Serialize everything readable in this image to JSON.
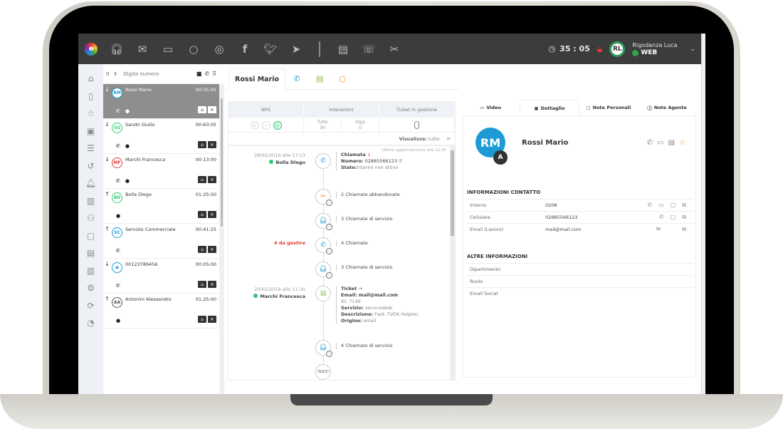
{
  "topbar": {
    "icons": [
      "logo-icon",
      "headset-icon",
      "mail-icon",
      "video-icon",
      "chat-icon",
      "webchat-icon",
      "facebook-icon",
      "twitter-icon",
      "telegram-icon",
      "clipboard-icon",
      "callback-icon",
      "hangup-icon"
    ],
    "timer": "35 : 05",
    "user": {
      "initials": "RL",
      "name": "Rigodanza Luca",
      "status": "WEB"
    }
  },
  "leftnav": {
    "items": [
      "home",
      "bookmark",
      "star",
      "contacts",
      "menu",
      "history",
      "bell",
      "fax",
      "team",
      "notes",
      "clipboard",
      "stats",
      "settings",
      "sync",
      "dashboard"
    ]
  },
  "dialer": {
    "prefix": "0",
    "placeholder": "Digita numero"
  },
  "calls": [
    {
      "dir": "↓",
      "initials": "RM",
      "name": "Rossi Mario",
      "time": "00:35:05",
      "color": "#1e9bd7",
      "channels": [
        "phone",
        "chat"
      ],
      "active": true
    },
    {
      "dir": "↓",
      "initials": "SG",
      "name": "Sandri Giulio",
      "time": "00:63:05",
      "color": "#2ecc71",
      "channels": [
        "phone",
        "chat"
      ],
      "active": false
    },
    {
      "dir": "↓",
      "initials": "MF",
      "name": "Marchi Francesca",
      "time": "00:13:00",
      "color": "#e53935",
      "channels": [
        "phone",
        "chat"
      ],
      "active": false
    },
    {
      "dir": "↑",
      "initials": "BD",
      "name": "Bolla Diego",
      "time": "01:25:00",
      "color": "#2ecc71",
      "channels": [
        "chat"
      ],
      "active": false
    },
    {
      "dir": "↑",
      "initials": "SC",
      "name": "Servizio Commerciale",
      "time": "00:41:25",
      "color": "#1e9bd7",
      "channels": [
        "phone"
      ],
      "active": false
    },
    {
      "dir": "↓",
      "initials": "◉",
      "name": "00123789456",
      "time": "00:05:00",
      "color": "#1e9bd7",
      "channels": [
        "phone"
      ],
      "active": false
    },
    {
      "dir": "↑",
      "initials": "AA",
      "name": "Antonini Alessandro",
      "time": "01:25:00",
      "color": "#555555",
      "channels": [
        "chat"
      ],
      "active": false
    }
  ],
  "center": {
    "tab_title": "Rossi Mario",
    "stats": {
      "nps_label": "NPS",
      "interactions_label": "Interazioni",
      "tickets_label": "Ticket in gestione",
      "all_label": "Tutte",
      "all_value": "30",
      "today_label": "Oggi",
      "today_value": "0",
      "tickets_value": "0"
    },
    "view_label": "Visualizza:",
    "view_value": "tutto",
    "updated": "Ultimo aggiornamento alle 11:35",
    "timeline": {
      "e1_date": "28/02/2019 alle 17:13",
      "e1_who": "Bolla Diego",
      "e1_title": "Chiamata",
      "e1_num_lbl": "Numero:",
      "e1_num": "02885566123",
      "e1_state_lbl": "Stato:",
      "e1_state": "interno non attivo",
      "e2": "2 Chiamate abbandonate",
      "e3": "3 Chiamate di servizio",
      "e4_pending": "4 da gestire",
      "e4": "4 Chiamate",
      "e5": "3 Chiamate di servizio",
      "e6_date": "20/02/2019 alle 11:30",
      "e6_who": "Marchi Francesca",
      "e6_title": "Ticket",
      "e6_email": "Email: mail@mail.com",
      "e6_id_lbl": "ID:",
      "e6_id": "7149",
      "e6_srv_lbl": "Servizio:",
      "e6_srv": "servicedesk",
      "e6_desc_lbl": "Descrizione:",
      "e6_desc": "Fwd: TVOX Helptec",
      "e6_orig_lbl": "Origine:",
      "e6_orig": "email",
      "e7": "4 Chiamate di servizio",
      "start": "INIZIO"
    }
  },
  "right": {
    "tabs": [
      "Video",
      "Dettaglio",
      "Note Personali",
      "Note Agente"
    ],
    "contact": {
      "initials": "RM",
      "badge": "A",
      "name": "Rossi Mario"
    },
    "contact_info_title": "INFORMAZIONI CONTATTO",
    "contact_info": [
      {
        "label": "Interno",
        "value": "0208"
      },
      {
        "label": "Cellulare",
        "value": "02885566123"
      },
      {
        "label": "Email (Lavoro)",
        "value": "mail@mail.com"
      }
    ],
    "other_info_title": "ALTRE INFORMAZIONI",
    "other_info": [
      "Dipartimento",
      "Ruolo",
      "Email Social"
    ]
  }
}
